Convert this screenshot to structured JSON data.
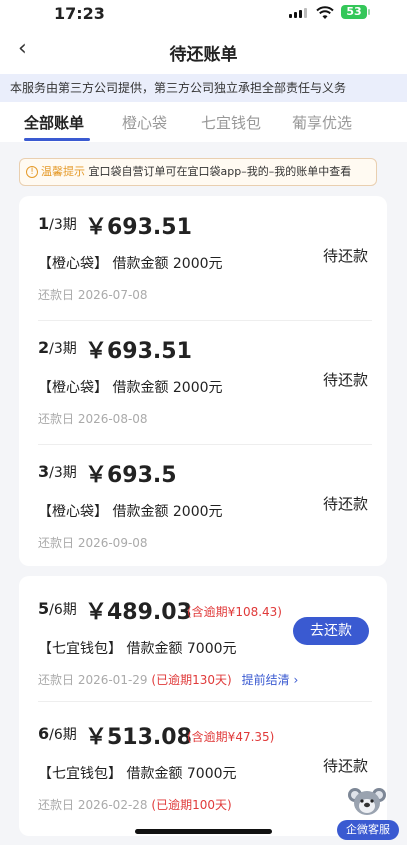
{
  "status_bar": {
    "time": "17:23",
    "battery": "53"
  },
  "nav": {
    "back": "‹",
    "title": "待还账单"
  },
  "notice": "本服务由第三方公司提供，第三方公司独立承担全部责任与义务",
  "tabs": [
    "全部账单",
    "橙心袋",
    "七宜钱包",
    "葡享优选"
  ],
  "tip": {
    "label": "温馨提示",
    "text": "宜口袋自营订单可在宜口袋app–我的–我的账单中查看"
  },
  "group1": [
    {
      "period_num": "1",
      "period_total": "/3期",
      "amount": "￥693.51",
      "product": "【橙心袋】 借款金额 2000元",
      "date": "还款日 2026-07-08",
      "status": "待还款"
    },
    {
      "period_num": "2",
      "period_total": "/3期",
      "amount": "￥693.51",
      "product": "【橙心袋】 借款金额 2000元",
      "date": "还款日 2026-08-08",
      "status": "待还款"
    },
    {
      "period_num": "3",
      "period_total": "/3期",
      "amount": "￥693.5",
      "product": "【橙心袋】 借款金额 2000元",
      "date": "还款日 2026-09-08",
      "status": "待还款"
    }
  ],
  "group2": [
    {
      "period_num": "5",
      "period_total": "/6期",
      "amount": "￥489.03",
      "overdue_interest": "(含逾期¥108.43)",
      "product": "【七宜钱包】 借款金额 7000元",
      "date": "还款日 2026-01-29",
      "overdue_days": "(已逾期130天)",
      "early": "提前结清 ›",
      "pay_button": "去还款"
    },
    {
      "period_num": "6",
      "period_total": "/6期",
      "amount": "￥513.08",
      "overdue_interest": "(含逾期¥47.35)",
      "product": "【七宜钱包】 借款金额 7000元",
      "date": "还款日 2026-02-28",
      "overdue_days": "(已逾期100天)",
      "status": "待还款"
    }
  ],
  "customer_service": "企微客服"
}
